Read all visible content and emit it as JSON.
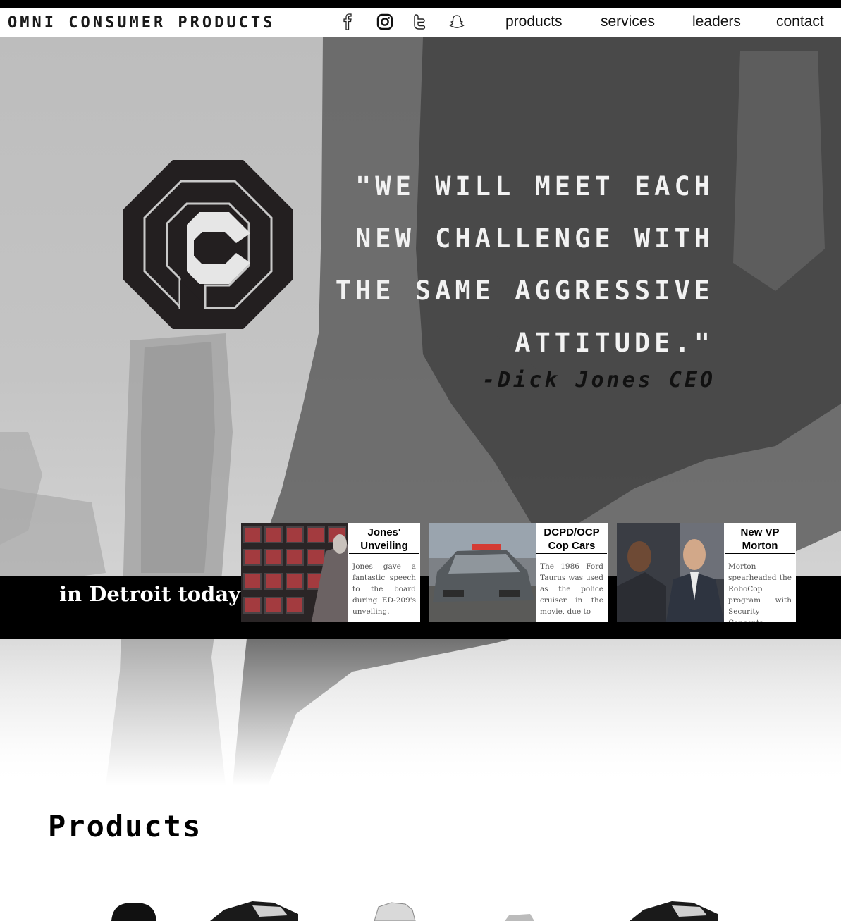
{
  "nav": {
    "brand": "OMNI CONSUMER PRODUCTS",
    "social": [
      "facebook-icon",
      "instagram-icon",
      "twitter-icon",
      "snapchat-icon"
    ],
    "links": [
      "products",
      "services",
      "leaders",
      "contact"
    ]
  },
  "hero": {
    "quote_lines": [
      "\"We will meet each",
      "new challenge with",
      "the same aggressive",
      "attitude.\""
    ],
    "attribution": "-Dick Jones CEO"
  },
  "news": {
    "title": "in Detroit today",
    "cards": [
      {
        "title": "Jones' Unveiling",
        "body": "Jones gave a fantastic speech to the board during ED-209's unveiling."
      },
      {
        "title": "DCPD/OCP Cop Cars",
        "body": "The 1986 Ford Taurus was used as the police cruiser in the movie, due to"
      },
      {
        "title": "New VP Morton",
        "body": "Morton spearheaded the RoboCop program with Security Concepts"
      }
    ]
  },
  "products": {
    "title": "Products"
  },
  "colors": {
    "nav_bg": "#ffffff",
    "band_bg": "#000000",
    "quote_text": "#f2f2f2"
  }
}
